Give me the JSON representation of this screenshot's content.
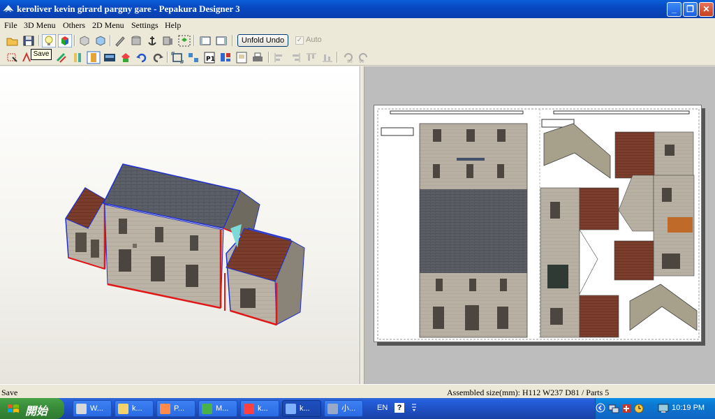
{
  "window": {
    "title": "keroliver kevin girard pargny gare - Pepakura Designer 3",
    "minimize": "_",
    "maximize": "❐",
    "close": "✕"
  },
  "menu": [
    "File",
    "3D Menu",
    "Others",
    "2D Menu",
    "Settings",
    "Help"
  ],
  "toolbar": {
    "unfold_undo": "Unfold Undo",
    "auto": "Auto",
    "tooltip": "Save"
  },
  "status": {
    "left": "Save",
    "right": "Assembled size(mm): H112  W237  D81 / Parts 5"
  },
  "taskbar": {
    "start": "開始",
    "tasks": [
      {
        "label": "W...",
        "color": "#d8d8d8",
        "icon": "media-icon"
      },
      {
        "label": "k...",
        "color": "#f3d36a",
        "icon": "folder-icon"
      },
      {
        "label": "P...",
        "color": "#ff8a4a",
        "icon": "pen-icon"
      },
      {
        "label": "M...",
        "color": "#49b34a",
        "icon": "leaf-icon"
      },
      {
        "label": "k...",
        "color": "#ff4040",
        "icon": "paint-icon"
      },
      {
        "label": "k...",
        "color": "#7fb0ff",
        "icon": "pepakura-icon"
      },
      {
        "label": "小...",
        "color": "#9aa8c8",
        "icon": "document-icon"
      }
    ],
    "language": "EN",
    "help": "?",
    "clock": "10:19 PM"
  },
  "colors": {
    "titlebar": "#0a4fc9",
    "fold_edge_red": "#e01818",
    "fold_edge_blue": "#2030d0",
    "roof_slate": "#5a5e66",
    "roof_tile": "#7a3a2a",
    "wall_stone": "#b8b0a2"
  }
}
